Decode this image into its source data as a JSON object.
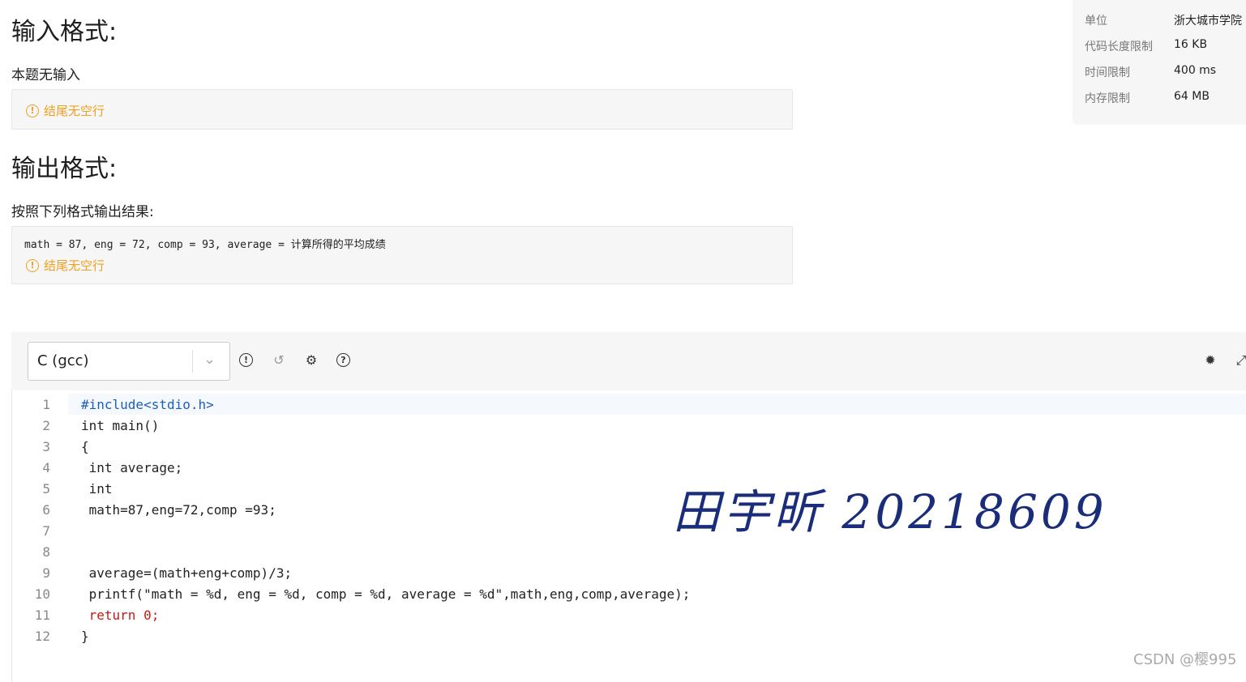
{
  "input_section": {
    "title": "输入格式:",
    "text": "本题无输入",
    "note": "结尾无空行"
  },
  "output_section": {
    "title": "输出格式:",
    "text": "按照下列格式输出结果:",
    "sample": "math = 87, eng = 72, comp = 93, average = 计算所得的平均成绩",
    "note": "结尾无空行"
  },
  "info": [
    {
      "k": "单位",
      "v": "浙大城市学院"
    },
    {
      "k": "代码长度限制",
      "v": "16 KB"
    },
    {
      "k": "时间限制",
      "v": "400 ms"
    },
    {
      "k": "内存限制",
      "v": "64 MB"
    }
  ],
  "editor": {
    "language": "C (gcc)",
    "icons": [
      "exclamation-icon",
      "history-icon",
      "gear-icon",
      "help-icon",
      "debug-icon",
      "fullscreen-icon"
    ]
  },
  "code_lines": [
    "#include<stdio.h>",
    "int main()",
    "{",
    " int average;",
    " int",
    " math=87,eng=72,comp =93;",
    "",
    " ",
    " average=(math+eng+comp)/3;",
    " printf(\"math = %d, eng = %d, comp = %d, average = %d\",math,eng,comp,average);",
    " return 0;",
    "}"
  ],
  "signature": "田宇昕 20218609",
  "watermark": "CSDN @樱995",
  "colors": {
    "warning": "#f0a020",
    "keyword": "#c41a16",
    "number": "#1c5fb8"
  }
}
